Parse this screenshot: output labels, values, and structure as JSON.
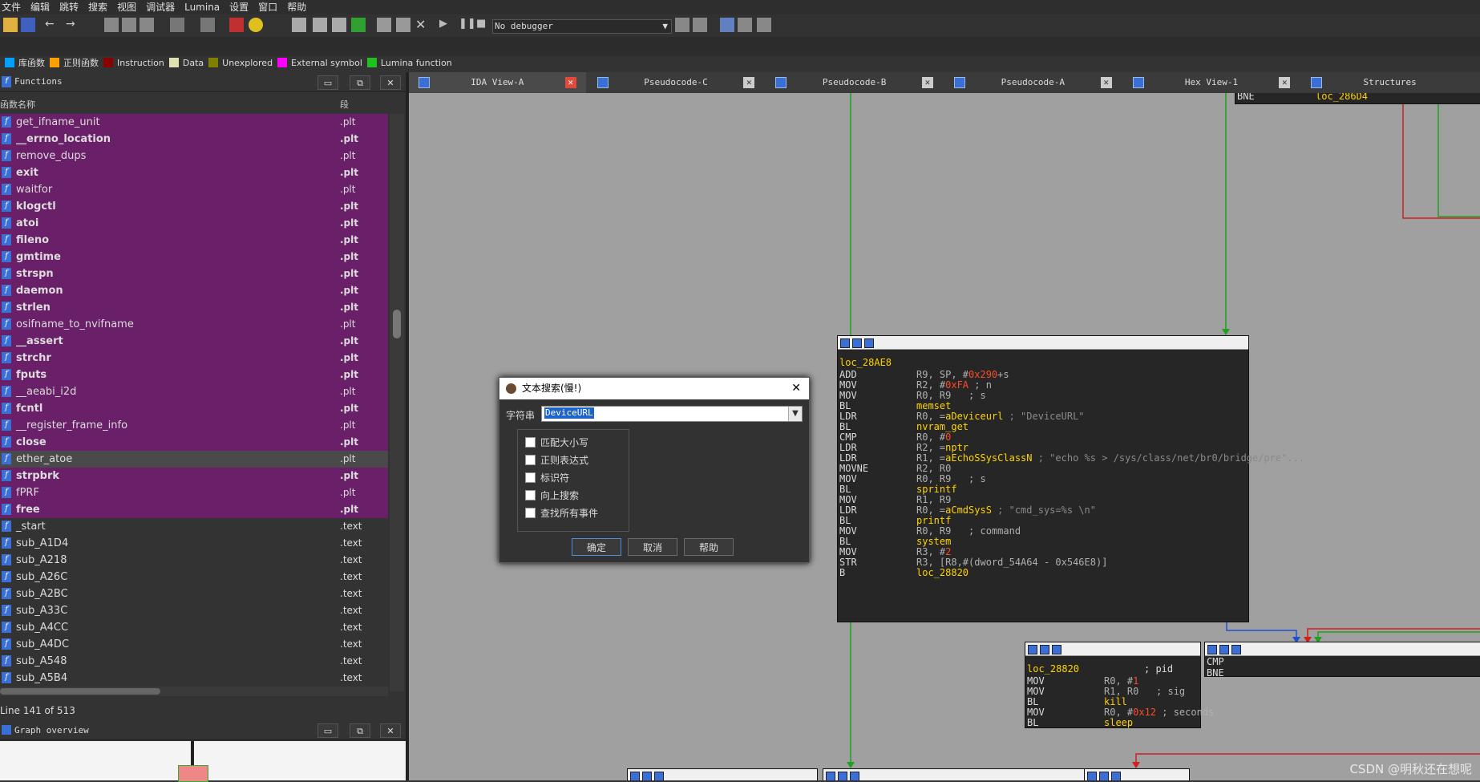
{
  "menu": [
    "文件",
    "编辑",
    "跳转",
    "搜索",
    "视图",
    "调试器",
    "Lumina",
    "设置",
    "窗口",
    "帮助"
  ],
  "toolbar": {
    "debugger_select": "No debugger"
  },
  "legend": [
    {
      "label": "库函数",
      "color": "#00a0ff"
    },
    {
      "label": "正则函数",
      "color": "#ffa000"
    },
    {
      "label": "Instruction",
      "color": "#8b0000"
    },
    {
      "label": "Data",
      "color": "#e0e0b0"
    },
    {
      "label": "Unexplored",
      "color": "#808000"
    },
    {
      "label": "External symbol",
      "color": "#ff00ff"
    },
    {
      "label": "Lumina function",
      "color": "#20c020"
    }
  ],
  "functions_panel": {
    "title": "Functions",
    "col_name": "函数名称",
    "col_seg": "段",
    "status": "Line 141 of 513",
    "rows": [
      {
        "name": "get_ifname_unit",
        "seg": ".plt",
        "bold": false,
        "hl": "ext"
      },
      {
        "name": "__errno_location",
        "seg": ".plt",
        "bold": true,
        "hl": "ext"
      },
      {
        "name": "remove_dups",
        "seg": ".plt",
        "bold": false,
        "hl": "ext"
      },
      {
        "name": "exit",
        "seg": ".plt",
        "bold": true,
        "hl": "ext"
      },
      {
        "name": "waitfor",
        "seg": ".plt",
        "bold": false,
        "hl": "ext"
      },
      {
        "name": "klogctl",
        "seg": ".plt",
        "bold": true,
        "hl": "ext"
      },
      {
        "name": "atoi",
        "seg": ".plt",
        "bold": true,
        "hl": "ext"
      },
      {
        "name": "fileno",
        "seg": ".plt",
        "bold": true,
        "hl": "ext"
      },
      {
        "name": "gmtime",
        "seg": ".plt",
        "bold": true,
        "hl": "ext"
      },
      {
        "name": "strspn",
        "seg": ".plt",
        "bold": true,
        "hl": "ext"
      },
      {
        "name": "daemon",
        "seg": ".plt",
        "bold": true,
        "hl": "ext"
      },
      {
        "name": "strlen",
        "seg": ".plt",
        "bold": true,
        "hl": "ext"
      },
      {
        "name": "osifname_to_nvifname",
        "seg": ".plt",
        "bold": false,
        "hl": "ext"
      },
      {
        "name": "__assert",
        "seg": ".plt",
        "bold": true,
        "hl": "ext"
      },
      {
        "name": "strchr",
        "seg": ".plt",
        "bold": true,
        "hl": "ext"
      },
      {
        "name": "fputs",
        "seg": ".plt",
        "bold": true,
        "hl": "ext"
      },
      {
        "name": "__aeabi_i2d",
        "seg": ".plt",
        "bold": false,
        "hl": "ext"
      },
      {
        "name": "fcntl",
        "seg": ".plt",
        "bold": true,
        "hl": "ext"
      },
      {
        "name": "__register_frame_info",
        "seg": ".plt",
        "bold": false,
        "hl": "ext"
      },
      {
        "name": "close",
        "seg": ".plt",
        "bold": true,
        "hl": "ext"
      },
      {
        "name": "ether_atoe",
        "seg": ".plt",
        "bold": false,
        "hl": "sel"
      },
      {
        "name": "strpbrk",
        "seg": ".plt",
        "bold": true,
        "hl": "ext"
      },
      {
        "name": "fPRF",
        "seg": ".plt",
        "bold": false,
        "hl": "ext"
      },
      {
        "name": "free",
        "seg": ".plt",
        "bold": true,
        "hl": "ext"
      },
      {
        "name": "_start",
        "seg": ".text",
        "bold": false,
        "hl": "none"
      },
      {
        "name": "sub_A1D4",
        "seg": ".text",
        "bold": false,
        "hl": "none"
      },
      {
        "name": "sub_A218",
        "seg": ".text",
        "bold": false,
        "hl": "none"
      },
      {
        "name": "sub_A26C",
        "seg": ".text",
        "bold": false,
        "hl": "none"
      },
      {
        "name": "sub_A2BC",
        "seg": ".text",
        "bold": false,
        "hl": "none"
      },
      {
        "name": "sub_A33C",
        "seg": ".text",
        "bold": false,
        "hl": "none"
      },
      {
        "name": "sub_A4CC",
        "seg": ".text",
        "bold": false,
        "hl": "none"
      },
      {
        "name": "sub_A4DC",
        "seg": ".text",
        "bold": false,
        "hl": "none"
      },
      {
        "name": "sub_A548",
        "seg": ".text",
        "bold": false,
        "hl": "none"
      },
      {
        "name": "sub_A5B4",
        "seg": ".text",
        "bold": false,
        "hl": "none"
      }
    ]
  },
  "graph_overview": {
    "title": "Graph overview"
  },
  "tabs": [
    {
      "label": "IDA View-A",
      "active": true
    },
    {
      "label": "Pseudocode-C",
      "active": false
    },
    {
      "label": "Pseudocode-B",
      "active": false
    },
    {
      "label": "Pseudocode-A",
      "active": false
    },
    {
      "label": "Hex View-1",
      "active": false
    },
    {
      "label": "Structures",
      "active": false
    }
  ],
  "graph": {
    "top_fragment": {
      "left": "BNE",
      "right": "loc_286D4"
    },
    "main_block": {
      "label": "loc_28AE8",
      "lines": [
        {
          "op": "ADD",
          "a": [
            [
              "reg",
              "R9, SP, #"
            ],
            [
              "num",
              "0x290"
            ],
            [
              "reg",
              "+s"
            ]
          ]
        },
        {
          "op": "MOV",
          "a": [
            [
              "reg",
              "R2, #"
            ],
            [
              "num",
              "0xFA"
            ],
            [
              "reg",
              " ; "
            ],
            [
              "reg",
              "n"
            ]
          ]
        },
        {
          "op": "MOV",
          "a": [
            [
              "reg",
              "R0, R9   ; s"
            ]
          ]
        },
        {
          "op": "BL",
          "a": [
            [
              "sym",
              "memset"
            ]
          ]
        },
        {
          "op": "LDR",
          "a": [
            [
              "reg",
              "R0, ="
            ],
            [
              "sym",
              "aDeviceurl"
            ],
            [
              "cmt",
              " ; \"DeviceURL\""
            ]
          ]
        },
        {
          "op": "BL",
          "a": [
            [
              "sym",
              "nvram_get"
            ]
          ]
        },
        {
          "op": "CMP",
          "a": [
            [
              "reg",
              "R0, #"
            ],
            [
              "num",
              "0"
            ]
          ]
        },
        {
          "op": "LDR",
          "a": [
            [
              "reg",
              "R2, ="
            ],
            [
              "sym",
              "nptr"
            ]
          ]
        },
        {
          "op": "LDR",
          "a": [
            [
              "reg",
              "R1, ="
            ],
            [
              "sym",
              "aEchoSSysClassN"
            ],
            [
              "cmt",
              " ; \"echo %s > /sys/class/net/br0/bridge/pre\"..."
            ]
          ]
        },
        {
          "op": "MOVNE",
          "a": [
            [
              "reg",
              "R2, R0"
            ]
          ]
        },
        {
          "op": "MOV",
          "a": [
            [
              "reg",
              "R0, R9   ; s"
            ]
          ]
        },
        {
          "op": "BL",
          "a": [
            [
              "sym",
              "sprintf"
            ]
          ]
        },
        {
          "op": "MOV",
          "a": [
            [
              "reg",
              "R1, R9"
            ]
          ]
        },
        {
          "op": "LDR",
          "a": [
            [
              "reg",
              "R0, ="
            ],
            [
              "sym",
              "aCmdSysS"
            ],
            [
              "cmt",
              " ; \"cmd_sys=%s \\n\""
            ]
          ]
        },
        {
          "op": "BL",
          "a": [
            [
              "sym",
              "printf"
            ]
          ]
        },
        {
          "op": "MOV",
          "a": [
            [
              "reg",
              "R0, R9   ; command"
            ]
          ]
        },
        {
          "op": "BL",
          "a": [
            [
              "sym",
              "system"
            ]
          ]
        },
        {
          "op": "MOV",
          "a": [
            [
              "reg",
              "R3, #"
            ],
            [
              "num",
              "2"
            ]
          ]
        },
        {
          "op": "STR",
          "a": [
            [
              "reg",
              "R3, [R8,#(dword_54A64 - 0x546E8)]"
            ]
          ]
        },
        {
          "op": "B",
          "a": [
            [
              "sym",
              "loc_28820"
            ]
          ]
        }
      ]
    },
    "second_block": {
      "label": "loc_28820",
      "label_comment": "; pid",
      "lines": [
        {
          "op": "MOV",
          "a": [
            [
              "reg",
              "R0, #"
            ],
            [
              "num",
              "1"
            ]
          ]
        },
        {
          "op": "MOV",
          "a": [
            [
              "reg",
              "R1, R0   ; sig"
            ]
          ]
        },
        {
          "op": "BL",
          "a": [
            [
              "sym",
              "kill"
            ]
          ]
        },
        {
          "op": "MOV",
          "a": [
            [
              "reg",
              "R0, #"
            ],
            [
              "num",
              "0x12"
            ],
            [
              "reg",
              " ; seconds"
            ]
          ]
        },
        {
          "op": "BL",
          "a": [
            [
              "sym",
              "sleep"
            ]
          ]
        }
      ]
    },
    "third_block": {
      "lines": [
        "CMP",
        "BNE"
      ]
    }
  },
  "dialog": {
    "title": "文本搜索(慢!)",
    "string_label": "字符串",
    "search_value": "DeviceURL",
    "options": [
      "匹配大小写",
      "正则表达式",
      "标识符",
      "向上搜索",
      "查找所有事件"
    ],
    "ok": "确定",
    "cancel": "取消",
    "help": "帮助"
  },
  "watermark": "CSDN @明秋还在想呢"
}
